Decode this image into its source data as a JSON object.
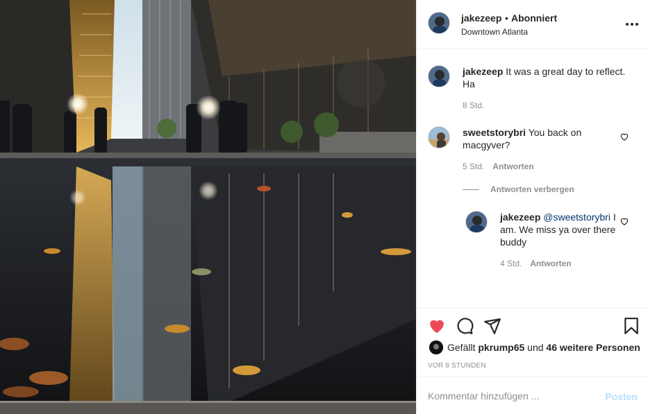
{
  "post": {
    "username": "jakezeep",
    "separator": "•",
    "follow_status": "Abonniert",
    "location": "Downtown Atlanta",
    "more_icon": "more-horizontal-icon"
  },
  "caption": {
    "username": "jakezeep",
    "text": "It was a great day to reflect. Ha",
    "time": "8 Std."
  },
  "comments": [
    {
      "username": "sweetstorybri",
      "text": "You back on macgyver?",
      "time": "5 Std.",
      "reply_label": "Antworten"
    }
  ],
  "hide_replies_label": "Antworten verbergen",
  "replies": [
    {
      "username": "jakezeep",
      "mention": "@sweetstorybri",
      "text": "I am. We miss ya over there buddy",
      "time": "4 Std.",
      "reply_label": "Antworten"
    }
  ],
  "actions": {
    "like_icon": "heart-filled-icon",
    "comment_icon": "comment-icon",
    "share_icon": "paper-plane-icon",
    "save_icon": "bookmark-icon",
    "like_color": "#ed4956"
  },
  "likes": {
    "prefix": "Gefällt",
    "user": "pkrump65",
    "conj": "und",
    "others": "46 weitere Personen"
  },
  "timestamp": "VOR 8 STUNDEN",
  "add_comment": {
    "placeholder": "Kommentar hinzufügen ...",
    "post_label": "Posten"
  }
}
